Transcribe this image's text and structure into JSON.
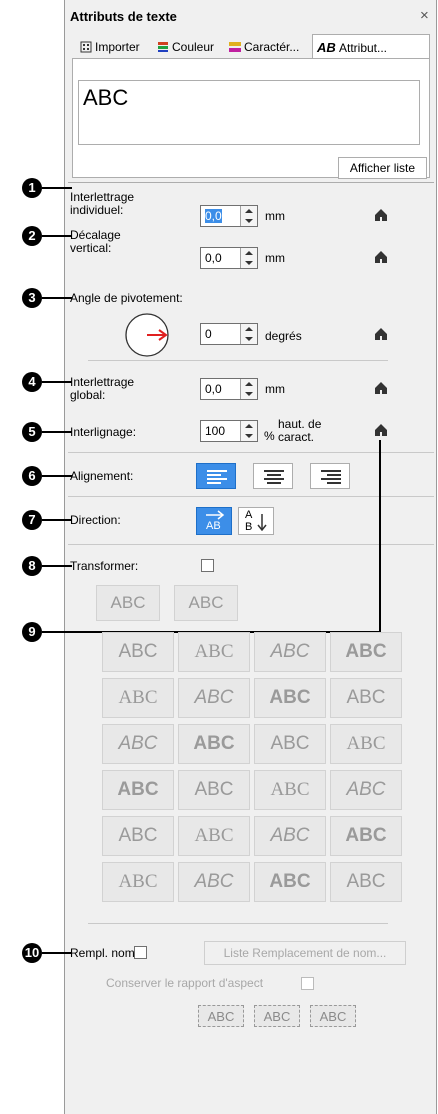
{
  "panel": {
    "title": "Attributs de texte",
    "close": "×"
  },
  "tabs": [
    {
      "label": "Importer",
      "icon": "import-icon"
    },
    {
      "label": "Couleur",
      "icon": "color-icon"
    },
    {
      "label": "Caractér...",
      "icon": "character-icon"
    },
    {
      "label": "Attribut...",
      "prefix": "AB",
      "icon": "attribute-icon"
    }
  ],
  "text_box": {
    "value": "ABC"
  },
  "show_list_button": "Afficher liste",
  "spacing": {
    "individual_label": "Interlettrage individuel:",
    "individual_value": "0,0",
    "individual_unit": "mm",
    "vertical_label": "Décalage vertical:",
    "vertical_value": "0,0",
    "vertical_unit": "mm",
    "rotation_label": "Angle de pivotement:",
    "rotation_value": "0",
    "rotation_unit": "degrés",
    "global_label": "Interlettrage global:",
    "global_value": "0,0",
    "global_unit": "mm",
    "line_label": "Interlignage:",
    "line_value": "100",
    "line_unit_a": "%",
    "line_unit_b": "haut. de caract."
  },
  "alignment": {
    "label": "Alignement:",
    "options": [
      "left",
      "center",
      "right"
    ],
    "selected": "left"
  },
  "direction": {
    "label": "Direction:",
    "selected": "horizontal",
    "h_text": "AB",
    "v_top": "A",
    "v_bottom": "B"
  },
  "transform": {
    "label": "Transformer:",
    "checked": false
  },
  "transform_tiles": [
    "ABC",
    "ABC"
  ],
  "shape_tiles": [
    "ABC",
    "ABC",
    "ABC",
    "ABC",
    "ABC",
    "ABC",
    "ABC",
    "ABC",
    "ABC",
    "ABC",
    "ABC",
    "ABC",
    "ABC",
    "ABC",
    "ABC",
    "ABC",
    "ABC",
    "ABC",
    "ABC",
    "ABC",
    "ABC",
    "ABC",
    "ABC",
    "ABC"
  ],
  "replace": {
    "label": "Rempl. nom",
    "checked": false,
    "list_button": "Liste Remplacement de nom...",
    "keep_ratio_label": "Conserver le rapport d'aspect",
    "keep_ratio_checked": false,
    "frame_tiles": [
      "ABC",
      "ABC",
      "ABC"
    ]
  },
  "callouts": [
    "1",
    "2",
    "3",
    "4",
    "5",
    "6",
    "7",
    "8",
    "9",
    "10"
  ],
  "colors": {
    "accent": "#3c8ee8",
    "arrow": "#e02020"
  }
}
